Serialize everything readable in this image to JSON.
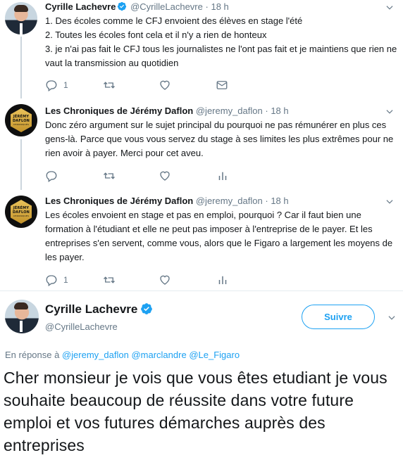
{
  "tweets": [
    {
      "author": "Cyrille Lachevre",
      "verified": true,
      "handle": "@CyrilleLachevre",
      "separator": "·",
      "time": "18 h",
      "lines": [
        "1. Des écoles comme le CFJ envoient des élèves en stage l'été",
        "2. Toutes les écoles font cela et il n'y a rien de honteux",
        "3. je n'ai pas fait le CFJ tous les journalistes ne l'ont pas fait et je maintiens que rien ne vaut la transmission au quotidien"
      ],
      "reply_count": "1",
      "retweet_count": "",
      "like_count": "",
      "last_action_icon": "mail-icon"
    },
    {
      "author": "Les Chroniques de Jérémy Daflon",
      "verified": false,
      "handle": "@jeremy_daflon",
      "separator": "·",
      "time": "18 h",
      "text": "Donc zéro argument sur le sujet principal du pourquoi ne pas rémunérer en plus ces gens-là. Parce que vous vous servez du stage à ses limites les plus extrêmes pour ne rien avoir à payer. Merci pour cet aveu.",
      "reply_count": "",
      "retweet_count": "",
      "like_count": "",
      "last_action_icon": "analytics-icon"
    },
    {
      "author": "Les Chroniques de Jérémy Daflon",
      "verified": false,
      "handle": "@jeremy_daflon",
      "separator": "·",
      "time": "18 h",
      "text": "Les écoles envoient en stage et pas en emploi, pourquoi ? Car il faut bien une formation à l'étudiant et elle ne peut pas imposer à l'entreprise de le payer. Et les entreprises s'en servent, comme vous, alors que le Figaro a largement les moyens de les payer.",
      "reply_count": "1",
      "retweet_count": "",
      "like_count": "",
      "last_action_icon": "analytics-icon"
    }
  ],
  "avatar_badge": {
    "line1": "JÉRÉMY",
    "line2": "DAFLON",
    "line3": "CHRONIQUES"
  },
  "main_tweet": {
    "author": "Cyrille Lachevre",
    "verified": true,
    "handle": "@CyrilleLachevre",
    "follow_label": "Suivre",
    "reply_prefix": "En réponse à",
    "reply_mentions": [
      "@jeremy_daflon",
      "@marclandre",
      "@Le_Figaro"
    ],
    "text": "Cher monsieur je vois que vous êtes etudiant je vous souhaite beaucoup de réussite dans votre future emploi et vos futures démarches auprès des entreprises"
  },
  "colors": {
    "accent": "#1da1f2",
    "secondary_text": "#657786",
    "primary_text": "#14171a",
    "divider": "#e6ecf0"
  }
}
